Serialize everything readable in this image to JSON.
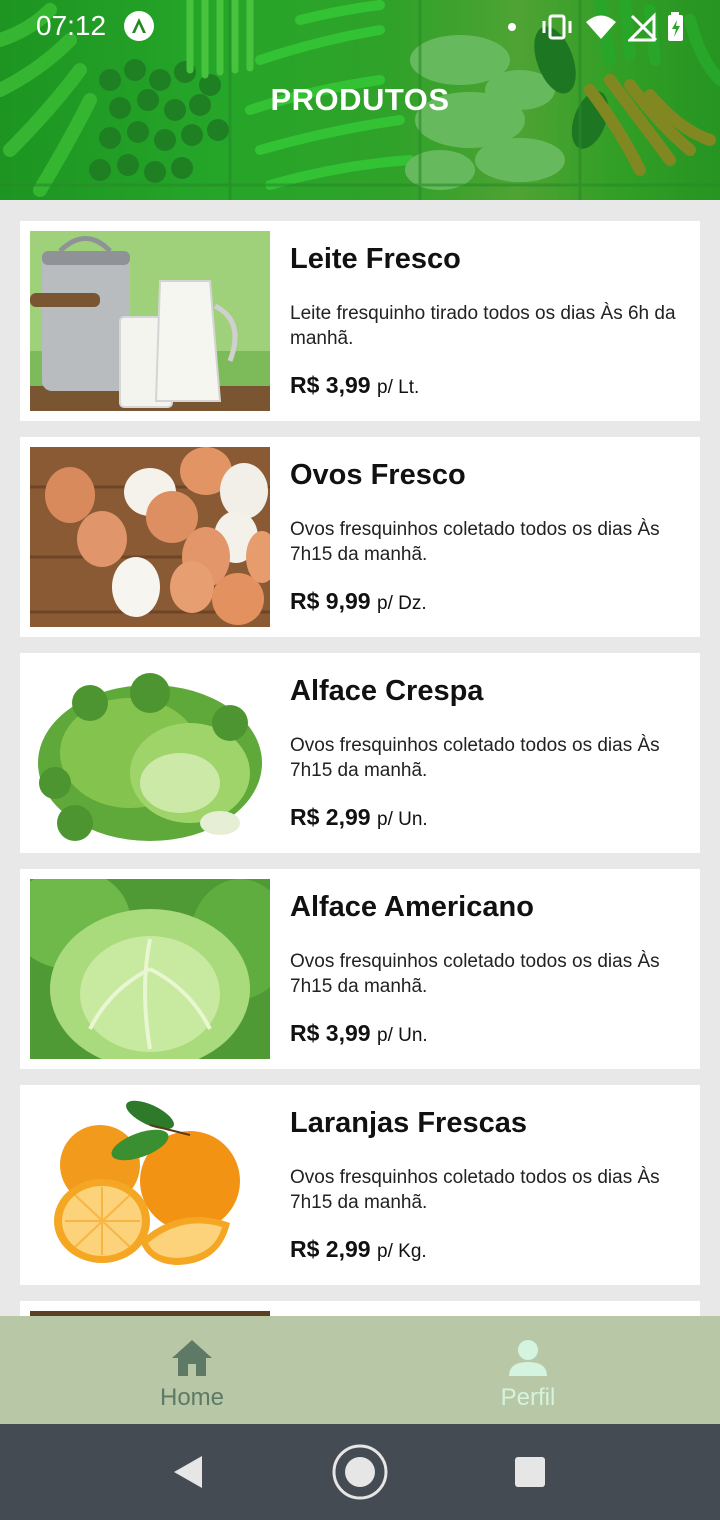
{
  "status_bar": {
    "time": "07:12",
    "icons": [
      "app-a-icon",
      "notification-dot-icon",
      "vibrate-icon",
      "wifi-icon",
      "no-signal-icon",
      "battery-charging-icon"
    ]
  },
  "header": {
    "title": "PRODUTOS"
  },
  "products": [
    {
      "name": "Leite Fresco",
      "description": "Leite fresquinho tirado todos os dias Às 6h da manhã.",
      "price": "R$ 3,99",
      "unit": "p/ Lt.",
      "image": "milk-image"
    },
    {
      "name": "Ovos Fresco",
      "description": "Ovos fresquinhos coletado todos os dias Às 7h15 da manhã.",
      "price": "R$ 9,99",
      "unit": "p/ Dz.",
      "image": "eggs-image"
    },
    {
      "name": "Alface Crespa",
      "description": "Ovos fresquinhos coletado todos os dias Às 7h15 da manhã.",
      "price": "R$ 2,99",
      "unit": "p/ Un.",
      "image": "curly-lettuce-image"
    },
    {
      "name": "Alface Americano",
      "description": "Ovos fresquinhos coletado todos os dias Às 7h15 da manhã.",
      "price": "R$ 3,99",
      "unit": "p/ Un.",
      "image": "iceberg-lettuce-image"
    },
    {
      "name": "Laranjas Frescas",
      "description": "Ovos fresquinhos coletado todos os dias Às 7h15 da manhã.",
      "price": "R$ 2,99",
      "unit": "p/ Kg.",
      "image": "oranges-image"
    }
  ],
  "bottom_nav": {
    "tabs": [
      {
        "label": "Home",
        "icon": "home-icon",
        "active": false
      },
      {
        "label": "Perfil",
        "icon": "person-icon",
        "active": true
      }
    ]
  },
  "system_nav": {
    "buttons": [
      "back-icon",
      "home-circle-icon",
      "recents-icon"
    ]
  },
  "colors": {
    "bottom_nav_bg": "#b8c7a6",
    "active_tab": "#d4f4df",
    "inactive_tab": "#5e7a66",
    "system_nav_bg": "#454b52"
  }
}
